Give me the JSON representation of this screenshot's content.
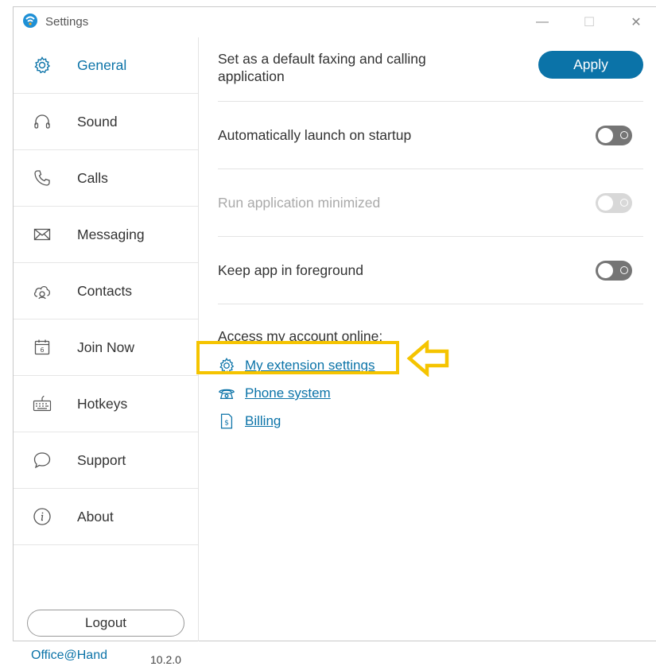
{
  "window": {
    "title": "Settings",
    "minimize_glyph": "—",
    "maximize_glyph": "☐",
    "close_glyph": "✕"
  },
  "sidebar": {
    "items": [
      {
        "label": "General",
        "icon": "gear-icon",
        "active": true
      },
      {
        "label": "Sound",
        "icon": "headphones-icon"
      },
      {
        "label": "Calls",
        "icon": "phone-icon"
      },
      {
        "label": "Messaging",
        "icon": "envelope-icon"
      },
      {
        "label": "Contacts",
        "icon": "cloud-contacts-icon"
      },
      {
        "label": "Join Now",
        "icon": "calendar-icon"
      },
      {
        "label": "Hotkeys",
        "icon": "keyboard-icon"
      },
      {
        "label": "Support",
        "icon": "chat-bubble-icon"
      },
      {
        "label": "About",
        "icon": "info-icon"
      }
    ],
    "logout_label": "Logout",
    "brand": "Office@Hand",
    "version": "10.2.0"
  },
  "general": {
    "default_app_text": "Set as a default faxing and calling application",
    "apply_label": "Apply",
    "toggles": [
      {
        "label": "Automatically launch on startup",
        "enabled": true,
        "on": false
      },
      {
        "label": "Run application minimized",
        "enabled": false,
        "on": false
      },
      {
        "label": "Keep app in foreground",
        "enabled": true,
        "on": false
      }
    ],
    "account_heading": "Access my account online:",
    "links": [
      {
        "label": "My extension settings",
        "icon": "gear-icon"
      },
      {
        "label": "Phone system",
        "icon": "desk-phone-icon"
      },
      {
        "label": "Billing",
        "icon": "bill-icon"
      }
    ]
  },
  "colors": {
    "accent": "#0b73a8",
    "highlight": "#f5c400",
    "toggle_off": "#757575"
  }
}
